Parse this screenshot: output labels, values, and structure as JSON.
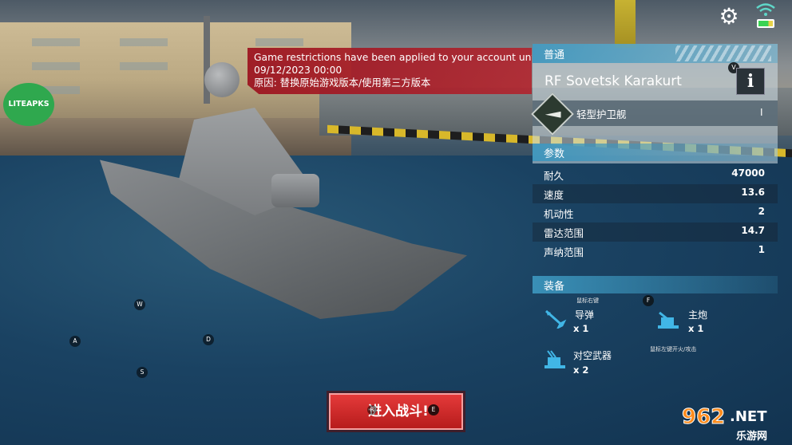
{
  "watermark_logo": {
    "text": "LITEAPKS",
    "color": "#2fa84e"
  },
  "restriction": {
    "line1": "Game restrictions have been applied to your account until",
    "line2": "09/12/2023 00:00",
    "line3": "原因: 替换原始游戏版本/使用第三方版本"
  },
  "panel": {
    "tier": "普通",
    "ship_name": "RF Sovetsk Karakurt",
    "info_label": "i",
    "info_hotkey": "V",
    "ship_class": "轻型护卫舰",
    "ship_class_value": "I"
  },
  "params": {
    "header": "参数",
    "rows": [
      {
        "label": "耐久",
        "value": "47000"
      },
      {
        "label": "速度",
        "value": "13.6"
      },
      {
        "label": "机动性",
        "value": "2"
      },
      {
        "label": "雷达范围",
        "value": "14.7"
      },
      {
        "label": "声纳范围",
        "value": "1"
      }
    ]
  },
  "equipment": {
    "header": "装备",
    "missile": {
      "label": "导弹",
      "count": "x 1",
      "hint": "鼠标右键"
    },
    "main_gun": {
      "label": "主炮",
      "count": "x 1",
      "hotkey": "F",
      "hint": "鼠标左键开火/攻击"
    },
    "aa": {
      "label": "对空武器",
      "count": "x 2"
    }
  },
  "controls": {
    "w": "W",
    "a": "A",
    "s": "S",
    "d": "D",
    "r": "R",
    "e": "E"
  },
  "battle_button": "进入战斗!",
  "site_watermark": {
    "num": "962",
    "net": ".NET",
    "cn": "乐游网"
  },
  "colors": {
    "accent": "#3c96be",
    "battle": "#d32f2f",
    "banner": "#9c121e"
  }
}
